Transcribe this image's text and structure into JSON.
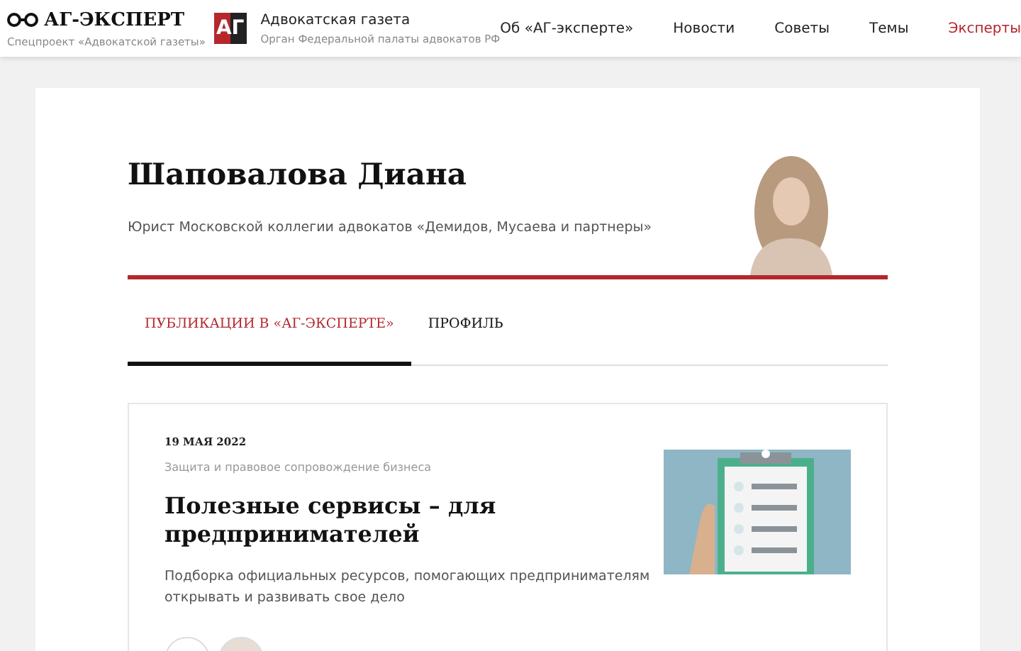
{
  "brand": {
    "title": "АГ-ЭКСПЕРТ",
    "subtitle": "Спецпроект «Адвокатской газеты»"
  },
  "partner": {
    "logo": "АГ",
    "title": "Адвокатская газета",
    "subtitle": "Орган Федеральной палаты адвокатов РФ"
  },
  "nav": [
    {
      "label": "Об «АГ-эксперте»",
      "selected": false
    },
    {
      "label": "Новости",
      "selected": false
    },
    {
      "label": "Советы",
      "selected": false
    },
    {
      "label": "Темы",
      "selected": false
    },
    {
      "label": "Эксперты",
      "selected": true
    }
  ],
  "profile": {
    "name": "Шаповалова Диана",
    "position": "Юрист Московской коллегии адвокатов «Демидов, Мусаева и партнеры»"
  },
  "tabs": [
    {
      "label": "ПУБЛИКАЦИИ В «АГ-ЭКСПЕРТЕ»",
      "selected": true
    },
    {
      "label": "ПРОФИЛЬ",
      "selected": false
    }
  ],
  "articles": [
    {
      "date": "19 МАЯ 2022",
      "category": "Защита и правовое сопровождение бизнеса",
      "title": "Полезные сервисы – для предпринимателей",
      "summary": "Подборка официальных ресурсов, помогающих предпринимателям открывать и развивать свое дело"
    }
  ]
}
